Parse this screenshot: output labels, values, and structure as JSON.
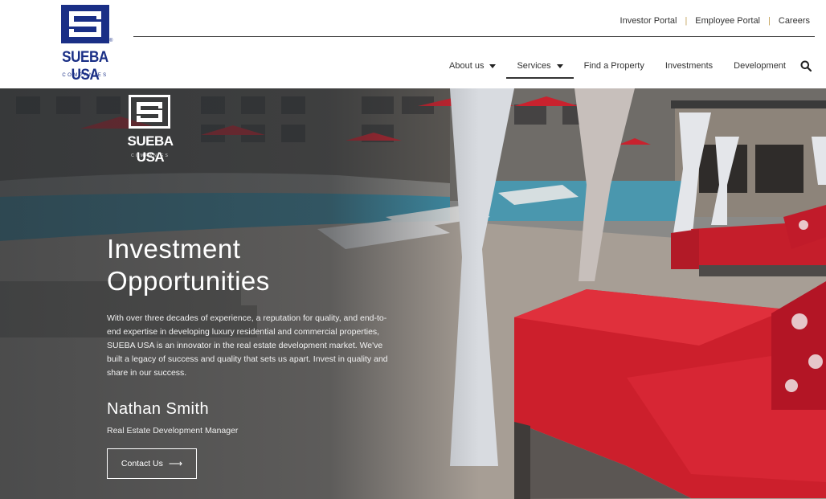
{
  "brand": {
    "name": "SUEBA USA",
    "sub": "COMPANIES",
    "registered": "®",
    "color": "#1a2f86"
  },
  "top_links": [
    "Investor Portal",
    "Employee Portal",
    "Careers"
  ],
  "nav": {
    "items": [
      {
        "label": "About us",
        "dropdown": true
      },
      {
        "label": "Services",
        "dropdown": true,
        "active": true
      },
      {
        "label": "Find a Property",
        "dropdown": false
      },
      {
        "label": "Investments",
        "dropdown": false
      },
      {
        "label": "Development",
        "dropdown": false
      }
    ],
    "search_icon": "search-icon"
  },
  "hero": {
    "logo_name": "SUEBA USA",
    "logo_sub": "COMPANIES",
    "title_line1": "Investment",
    "title_line2": "Opportunities",
    "text": "With over three decades of experience, a reputation for quality, and end-to-end expertise in developing luxury residential and commercial properties, SUEBA USA is an innovator in the real estate development market. We've built a legacy of success and quality that sets us apart. Invest in quality and share in our success.",
    "person_name": "Nathan Smith",
    "person_role": "Real Estate Development Manager",
    "button_label": "Contact Us",
    "button_icon": "arrow-right-icon",
    "cushion_color": "#d1212e"
  }
}
